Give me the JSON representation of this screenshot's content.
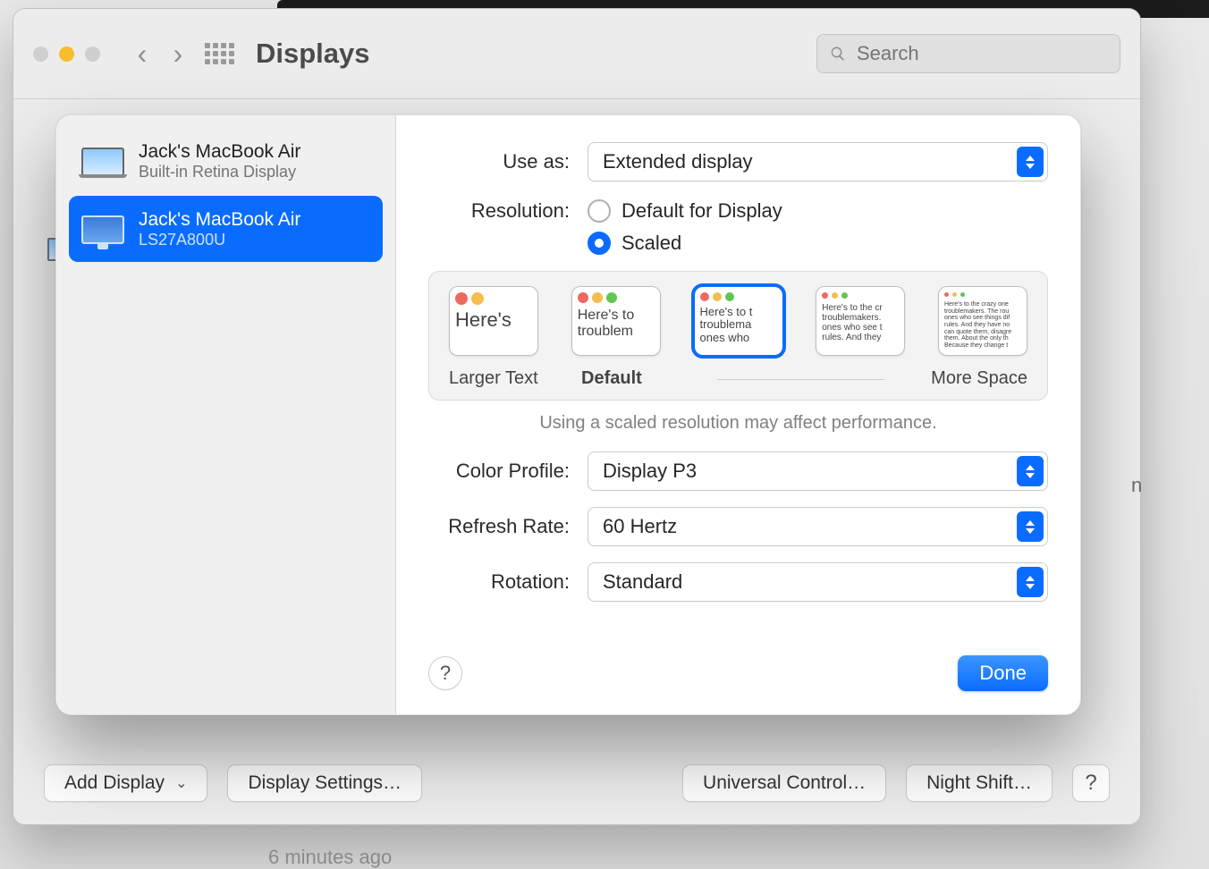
{
  "window": {
    "title": "Displays",
    "search_placeholder": "Search"
  },
  "footer": {
    "add_display": "Add Display",
    "display_settings": "Display Settings…",
    "universal_control": "Universal Control…",
    "night_shift": "Night Shift…"
  },
  "sheet": {
    "devices": [
      {
        "name": "Jack's MacBook Air",
        "subtitle": "Built-in Retina Display",
        "type": "laptop",
        "selected": false
      },
      {
        "name": "Jack's MacBook Air",
        "subtitle": "LS27A800U",
        "type": "monitor",
        "selected": true
      }
    ],
    "fields": {
      "use_as": {
        "label": "Use as:",
        "value": "Extended display"
      },
      "resolution": {
        "label": "Resolution:",
        "options": {
          "default": "Default for Display",
          "scaled": "Scaled"
        },
        "selected": "scaled",
        "thumbs_labels": {
          "left": "Larger Text",
          "mid": "Default",
          "right": "More Space"
        },
        "hint": "Using a scaled resolution may affect performance.",
        "selected_thumb_index": 2,
        "sample_texts": [
          "Here's",
          "Here's to troublem",
          "Here's to t troublema ones who",
          "Here's to the cr troublemakers. ones who see t rules. And they",
          "Here's to the crazy one troublemakers. The rou ones who see things dif rules. And they have no can quote them, disagre them. About the only th Because they change t"
        ]
      },
      "color_profile": {
        "label": "Color Profile:",
        "value": "Display P3"
      },
      "refresh_rate": {
        "label": "Refresh Rate:",
        "value": "60 Hertz"
      },
      "rotation": {
        "label": "Rotation:",
        "value": "Standard"
      }
    },
    "done": "Done"
  },
  "behind": {
    "peek_bottom": "6 minutes ago"
  }
}
